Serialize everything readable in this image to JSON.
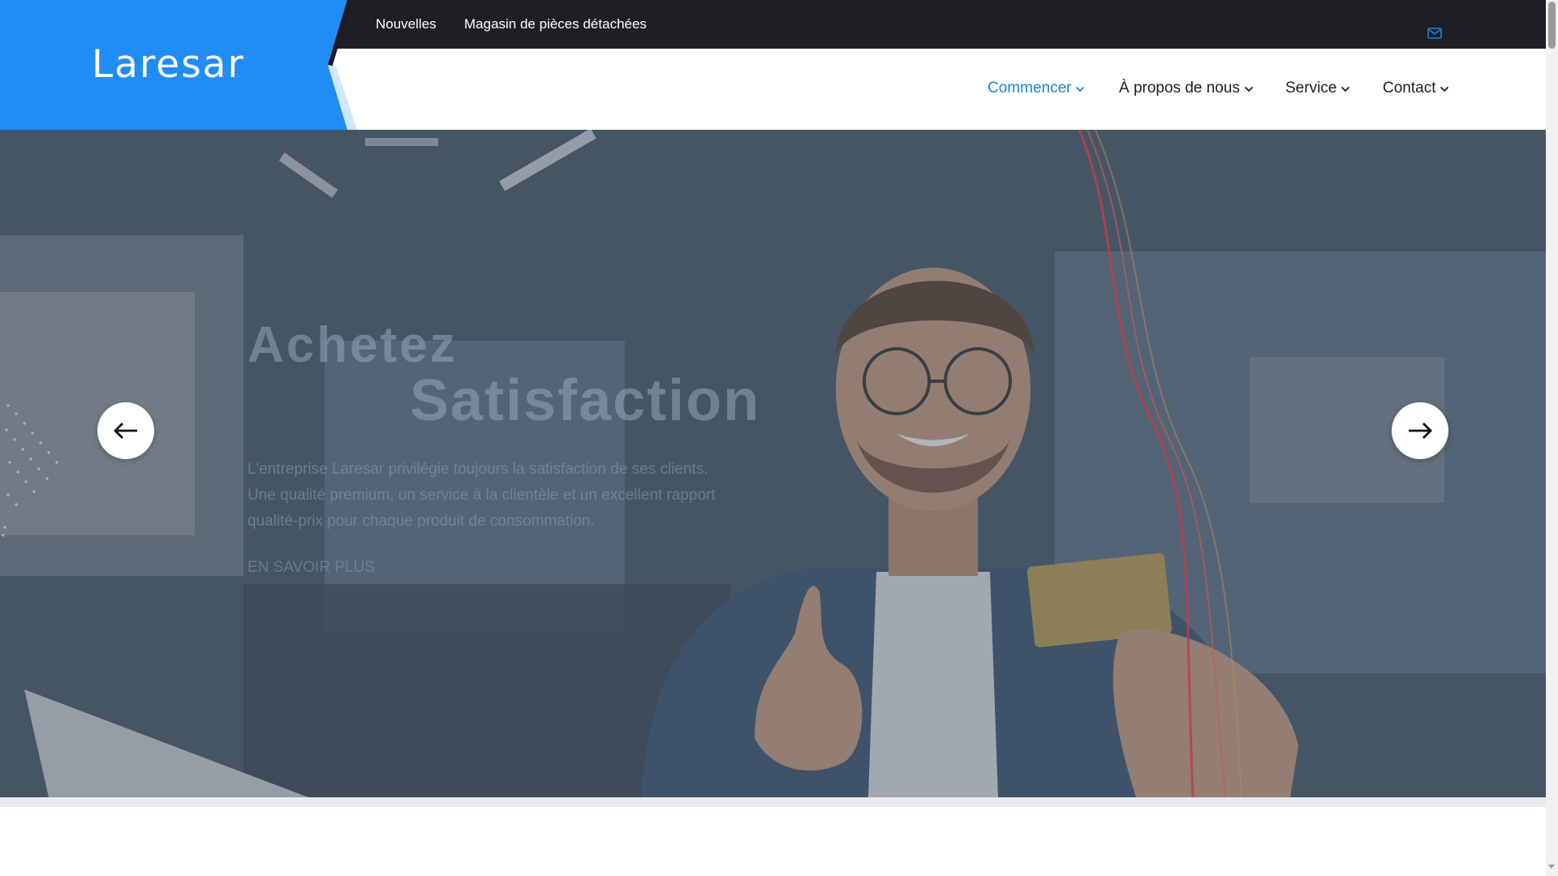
{
  "brand": {
    "logo_text": "Laresar",
    "accent_color": "#1f8df5",
    "dark_bar_color": "#1d1f24"
  },
  "topbar": {
    "links": [
      {
        "label": "Nouvelles"
      },
      {
        "label": "Magasin de pièces détachées"
      }
    ],
    "icons": [
      "mail-icon"
    ]
  },
  "nav": {
    "items": [
      {
        "label": "Commencer",
        "active": true,
        "icon": "chevron-down-icon"
      },
      {
        "label": "À propos de nous",
        "active": false,
        "icon": "chevron-down-icon"
      },
      {
        "label": "Service",
        "active": false,
        "icon": "chevron-down-icon"
      },
      {
        "label": "Contact",
        "active": false,
        "icon": "chevron-down-icon"
      }
    ],
    "active_color": "#1a83d6"
  },
  "hero": {
    "title_line1": "Achetez",
    "title_line2": "Satisfaction",
    "description": "L'entreprise Laresar privilégie toujours la satisfaction de ses clients. Une qualité premium, un service à la clientèle et un excellent rapport qualité-prix pour chaque produit de consommation.",
    "cta": "EN SAVOIR PLUS",
    "prev_icon": "arrow-left-icon",
    "next_icon": "arrow-right-icon"
  }
}
